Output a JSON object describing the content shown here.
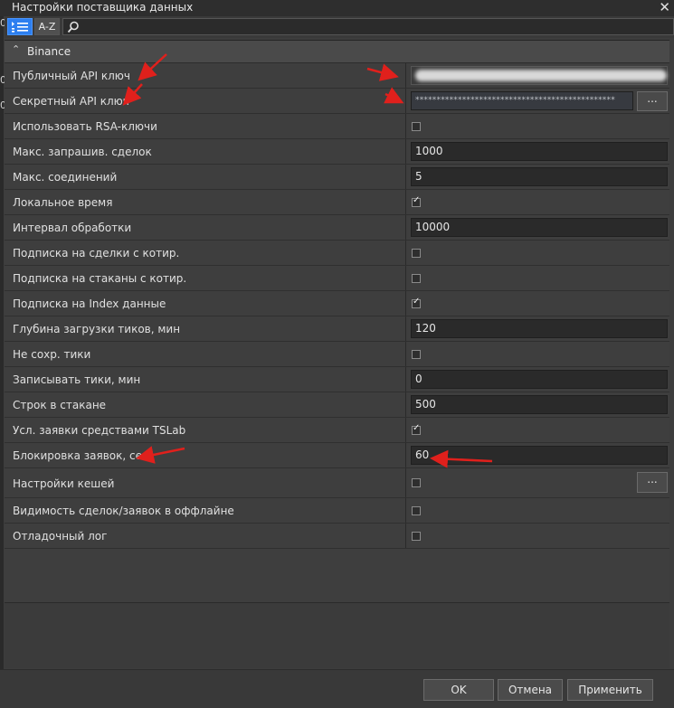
{
  "window": {
    "title": "Настройки поставщика данных"
  },
  "toolbar": {
    "az_label": "A-Z",
    "search_placeholder": ""
  },
  "group": {
    "name": "Binance"
  },
  "rows": [
    {
      "label": "Публичный API ключ",
      "type": "blurred"
    },
    {
      "label": "Секретный API ключ",
      "type": "password",
      "value": "***********************************************",
      "button": "..."
    },
    {
      "label": "Использовать RSA-ключи",
      "type": "checkbox",
      "checked": false
    },
    {
      "label": "Макс. запрашив. сделок",
      "type": "text",
      "value": "1000"
    },
    {
      "label": "Макс. соединений",
      "type": "text",
      "value": "5"
    },
    {
      "label": "Локальное время",
      "type": "checkbox",
      "checked": true
    },
    {
      "label": "Интервал обработки",
      "type": "text",
      "value": "10000"
    },
    {
      "label": "Подписка на сделки с котир.",
      "type": "checkbox",
      "checked": false
    },
    {
      "label": "Подписка на стаканы с котир.",
      "type": "checkbox",
      "checked": false
    },
    {
      "label": "Подписка на Index данные",
      "type": "checkbox",
      "checked": true
    },
    {
      "label": "Глубина загрузки тиков, мин",
      "type": "text",
      "value": "120"
    },
    {
      "label": "Не сохр. тики",
      "type": "checkbox",
      "checked": false
    },
    {
      "label": "Записывать тики, мин",
      "type": "text",
      "value": "0"
    },
    {
      "label": "Строк в стакане",
      "type": "text",
      "value": "500"
    },
    {
      "label": "Усл. заявки средствами TSLab",
      "type": "checkbox",
      "checked": true
    },
    {
      "label": "Блокировка заявок, сек",
      "type": "text",
      "value": "60"
    },
    {
      "label": "Настройки кешей",
      "type": "checkbox",
      "checked": false,
      "button": "..."
    },
    {
      "label": "Видимость сделок/заявок в оффлайне",
      "type": "checkbox",
      "checked": false
    },
    {
      "label": "Отладочный лог",
      "type": "checkbox",
      "checked": false
    }
  ],
  "footer": {
    "ok": "OK",
    "cancel": "Отмена",
    "apply": "Применить"
  },
  "left_fragments": [
    "0",
    "0",
    "0"
  ],
  "colors": {
    "accent": "#2d7ff0",
    "arrow": "#e0201c"
  }
}
